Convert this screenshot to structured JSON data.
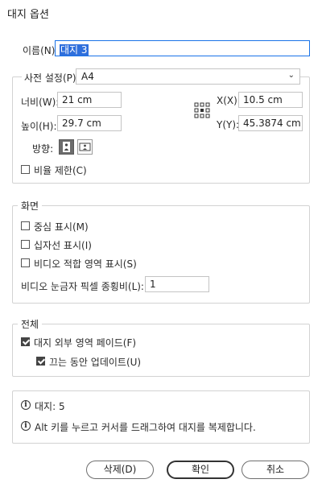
{
  "window": {
    "title": "대지 옵션"
  },
  "name": {
    "label": "이름(N):",
    "value": "대지 3"
  },
  "preset_section": {
    "preset_label": "사전 설정(P):",
    "preset_value": "A4",
    "width_label": "너비(W):",
    "width_value": "21 cm",
    "height_label": "높이(H):",
    "height_value": "29.7 cm",
    "x_label": "X(X):",
    "x_value": "10.5 cm",
    "y_label": "Y(Y):",
    "y_value": "45.3874 cm",
    "orientation_label": "방향:",
    "orientation_selected": "portrait",
    "constrain_label": "비율 제한(C)",
    "constrain_checked": false
  },
  "display": {
    "legend": "화면",
    "center_label": "중심 표시(M)",
    "center_checked": false,
    "crosshair_label": "십자선 표시(I)",
    "crosshair_checked": false,
    "video_safe_label": "비디오 적합 영역 표시(S)",
    "video_safe_checked": false,
    "pixel_ratio_label": "비디오 눈금자 픽셀 종횡비(L):",
    "pixel_ratio_value": "1"
  },
  "global": {
    "legend": "전체",
    "fade_label": "대지 외부 영역 페이드(F)",
    "fade_checked": true,
    "update_label": "끄는 동안 업데이트(U)",
    "update_checked": true
  },
  "info": {
    "count_text": "대지: 5",
    "tip_text": "Alt 키를 누르고 커서를 드래그하여 대지를 복제합니다."
  },
  "buttons": {
    "delete": "삭제(D)",
    "ok": "확인",
    "cancel": "취소"
  },
  "colors": {
    "accent": "#1a73e8",
    "selection": "#2f6fdc"
  }
}
